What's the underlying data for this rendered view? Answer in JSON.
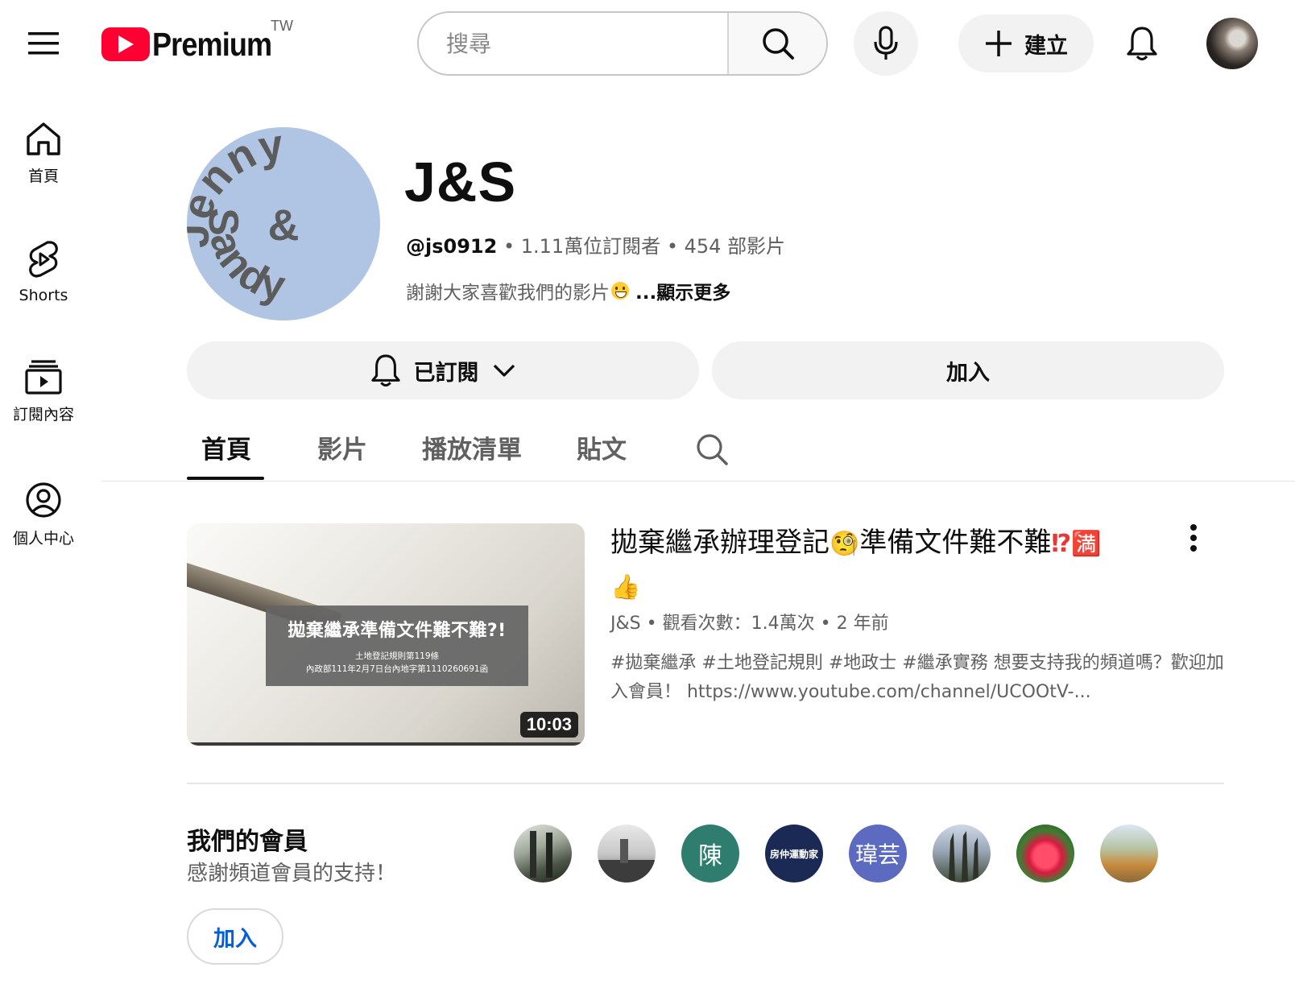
{
  "topbar": {
    "logo_text": "Premium",
    "region": "TW",
    "search_placeholder": "搜尋",
    "create_label": "建立"
  },
  "nav": {
    "items": [
      {
        "label": "首頁",
        "icon": "home-icon"
      },
      {
        "label": "Shorts",
        "icon": "shorts-icon"
      },
      {
        "label": "訂閱內容",
        "icon": "subscriptions-icon"
      },
      {
        "label": "個人中心",
        "icon": "you-icon"
      }
    ]
  },
  "channel": {
    "avatar_text": [
      "Jenny",
      "&",
      "Sandy"
    ],
    "name": "J&S",
    "handle": "@js0912",
    "subscribers": "1.11萬位訂閱者",
    "video_count": "454 部影片",
    "description": "謝謝大家喜歡我們的影片",
    "description_emoji": "grinning-face-emoji",
    "show_more": "...顯示更多",
    "subscribed_label": "已訂閱",
    "join_label": "加入"
  },
  "tabs": [
    {
      "label": "首頁",
      "active": true
    },
    {
      "label": "影片",
      "active": false
    },
    {
      "label": "播放清單",
      "active": false
    },
    {
      "label": "貼文",
      "active": false
    }
  ],
  "featured_video": {
    "thumb_title": "拋棄繼承準備文件難不難?!",
    "thumb_sub_1": "土地登記規則第119條",
    "thumb_sub_2": "內政部111年2月7日台內地字第1110260691函",
    "duration": "10:03",
    "title_part1": "拋棄繼承辦理登記",
    "title_emoji1": "🧐",
    "title_part2": "準備文件難不難",
    "title_emoji2": "⁉",
    "title_emoji3": "🈵",
    "title_emoji4": "👍",
    "channel": "J&S",
    "views": "觀看次數：1.4萬次",
    "age": "2 年前",
    "description": "#拋棄繼承 #土地登記規則 #地政士 #繼承實務 想要支持我的頻道嗎？歡迎加入會員！ https://www.youtube.com/channel/UCOOtV-..."
  },
  "members": {
    "title": "我們的會員",
    "subtitle": "感謝頻道會員的支持！",
    "join_label": "加入",
    "avatars": [
      {
        "kind": "photo",
        "text": ""
      },
      {
        "kind": "photo",
        "text": ""
      },
      {
        "kind": "letter",
        "text": "陳",
        "color": "#2e7d6e"
      },
      {
        "kind": "logo",
        "text": "房仲運動家",
        "color": "#1b2a55"
      },
      {
        "kind": "letter",
        "text": "瑋芸",
        "color": "#5c6bc0"
      },
      {
        "kind": "photo",
        "text": ""
      },
      {
        "kind": "photo",
        "text": ""
      },
      {
        "kind": "photo",
        "text": ""
      }
    ]
  },
  "colors": {
    "brand_red": "#ff0033",
    "link_blue": "#065fd4",
    "chip_bg": "#f2f2f2",
    "avatar_bg": "#b0c4e4"
  }
}
